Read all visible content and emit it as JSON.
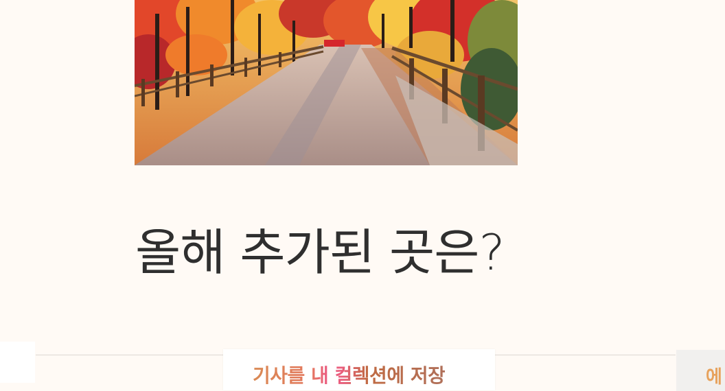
{
  "hero": {
    "alt": "autumn foliage path"
  },
  "section": {
    "heading": "올해 추가된 곳은?"
  },
  "save_banner": {
    "label": "기사를 내 컬렉션에 저장"
  },
  "right_panel": {
    "label": "에"
  },
  "colors": {
    "background": "#fffaf5",
    "heading": "#2f2f2f",
    "accent_orange": "#e4795f",
    "accent_pink": "#ea5e7e"
  }
}
